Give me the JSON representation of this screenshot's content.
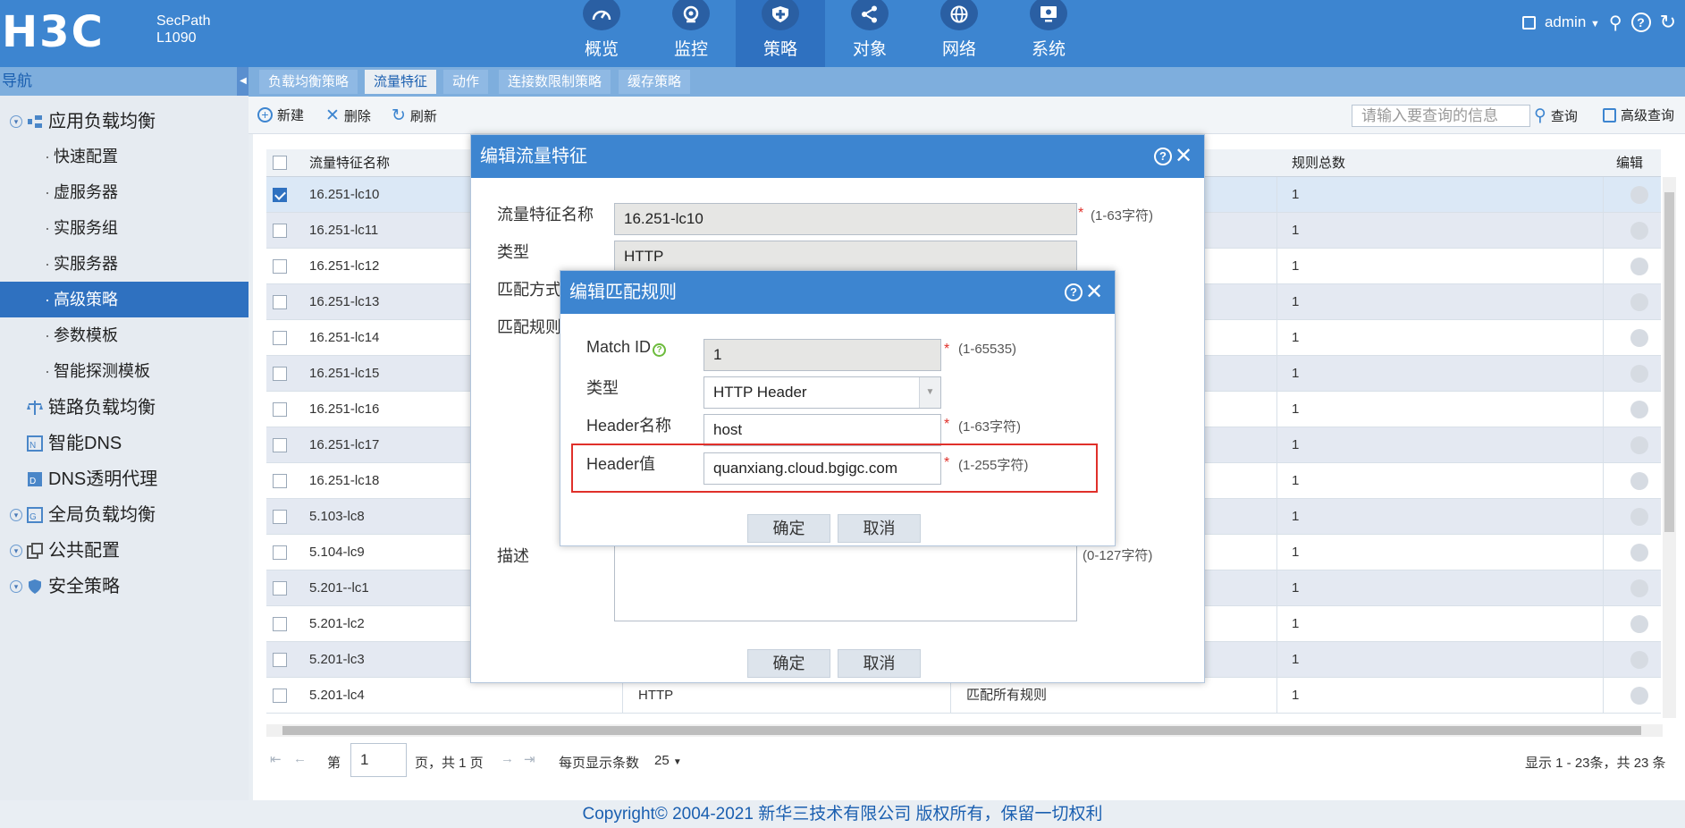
{
  "header": {
    "logo": "H3C",
    "product_line1": "SecPath",
    "product_line2": "L1090",
    "nav": [
      {
        "label": "概览",
        "icon": "gauge-icon"
      },
      {
        "label": "监控",
        "icon": "monitor-icon"
      },
      {
        "label": "策略",
        "icon": "shield-icon"
      },
      {
        "label": "对象",
        "icon": "share-icon"
      },
      {
        "label": "网络",
        "icon": "globe-icon"
      },
      {
        "label": "系统",
        "icon": "system-icon"
      }
    ],
    "active_nav": "策略",
    "user": "admin"
  },
  "sidebar": {
    "header": "导航",
    "items": [
      {
        "label": "应用负载均衡"
      },
      {
        "label": "快速配置"
      },
      {
        "label": "虚服务器"
      },
      {
        "label": "实服务组"
      },
      {
        "label": "实服务器"
      },
      {
        "label": "高级策略"
      },
      {
        "label": "参数模板"
      },
      {
        "label": "智能探测模板"
      },
      {
        "label": "链路负载均衡"
      },
      {
        "label": "智能DNS"
      },
      {
        "label": "DNS透明代理"
      },
      {
        "label": "全局负载均衡"
      },
      {
        "label": "公共配置"
      },
      {
        "label": "安全策略"
      }
    ]
  },
  "tabs": [
    "负载均衡策略",
    "流量特征",
    "动作",
    "连接数限制策略",
    "缓存策略"
  ],
  "active_tab": "流量特征",
  "toolbar": {
    "new_label": "新建",
    "delete_label": "删除",
    "refresh_label": "刷新",
    "search_placeholder": "请输入要查询的信息",
    "query_label": "查询",
    "advanced_query_label": "高级查询"
  },
  "table": {
    "columns": [
      "流量特征名称",
      "规则总数",
      "编辑"
    ],
    "rows": [
      {
        "name": "16.251-lc10",
        "type": "",
        "match": "",
        "count": "1",
        "selected": true
      },
      {
        "name": "16.251-lc11",
        "type": "",
        "match": "",
        "count": "1"
      },
      {
        "name": "16.251-lc12",
        "type": "",
        "match": "",
        "count": "1"
      },
      {
        "name": "16.251-lc13",
        "type": "",
        "match": "",
        "count": "1"
      },
      {
        "name": "16.251-lc14",
        "type": "",
        "match": "",
        "count": "1"
      },
      {
        "name": "16.251-lc15",
        "type": "",
        "match": "",
        "count": "1"
      },
      {
        "name": "16.251-lc16",
        "type": "",
        "match": "",
        "count": "1"
      },
      {
        "name": "16.251-lc17",
        "type": "",
        "match": "",
        "count": "1"
      },
      {
        "name": "16.251-lc18",
        "type": "",
        "match": "",
        "count": "1"
      },
      {
        "name": "5.103-lc8",
        "type": "",
        "match": "",
        "count": "1"
      },
      {
        "name": "5.104-lc9",
        "type": "",
        "match": "",
        "count": "1"
      },
      {
        "name": "5.201--lc1",
        "type": "",
        "match": "",
        "count": "1"
      },
      {
        "name": "5.201-lc2",
        "type": "",
        "match": "",
        "count": "1"
      },
      {
        "name": "5.201-lc3",
        "type": "",
        "match": "",
        "count": "1"
      },
      {
        "name": "5.201-lc4",
        "type": "HTTP",
        "match": "匹配所有规则",
        "count": "1"
      }
    ]
  },
  "pager": {
    "page_prefix": "第",
    "page_value": "1",
    "page_suffix": "页，共 1 页",
    "per_page_label": "每页显示条数",
    "per_page_value": "25",
    "summary": "显示 1 - 23条，共 23 条"
  },
  "footer": "Copyright© 2004-2021 新华三技术有限公司 版权所有，保留一切权利",
  "dialog_outer": {
    "title": "编辑流量特征",
    "name_label": "流量特征名称",
    "name_value": "16.251-lc10",
    "name_hint": "(1-63字符)",
    "type_label": "类型",
    "type_value": "HTTP",
    "match_mode_label": "匹配方式",
    "rules_label": "匹配规则",
    "desc_label": "描述",
    "desc_hint": "(0-127字符)",
    "ok_label": "确定",
    "cancel_label": "取消"
  },
  "dialog_inner": {
    "title": "编辑匹配规则",
    "match_id_label": "Match ID",
    "match_id_value": "1",
    "match_id_hint": "(1-65535)",
    "type_label": "类型",
    "type_value": "HTTP Header",
    "header_name_label": "Header名称",
    "header_name_value": "host",
    "header_name_hint": "(1-63字符)",
    "header_value_label": "Header值",
    "header_value_value": "quanxiang.cloud.bgigc.com",
    "header_value_hint": "(1-255字符)",
    "ok_label": "确定",
    "cancel_label": "取消"
  },
  "colors": {
    "header_bg": "#3d85d0",
    "active_blue": "#2f71c0",
    "highlight_red": "#e0302a"
  }
}
